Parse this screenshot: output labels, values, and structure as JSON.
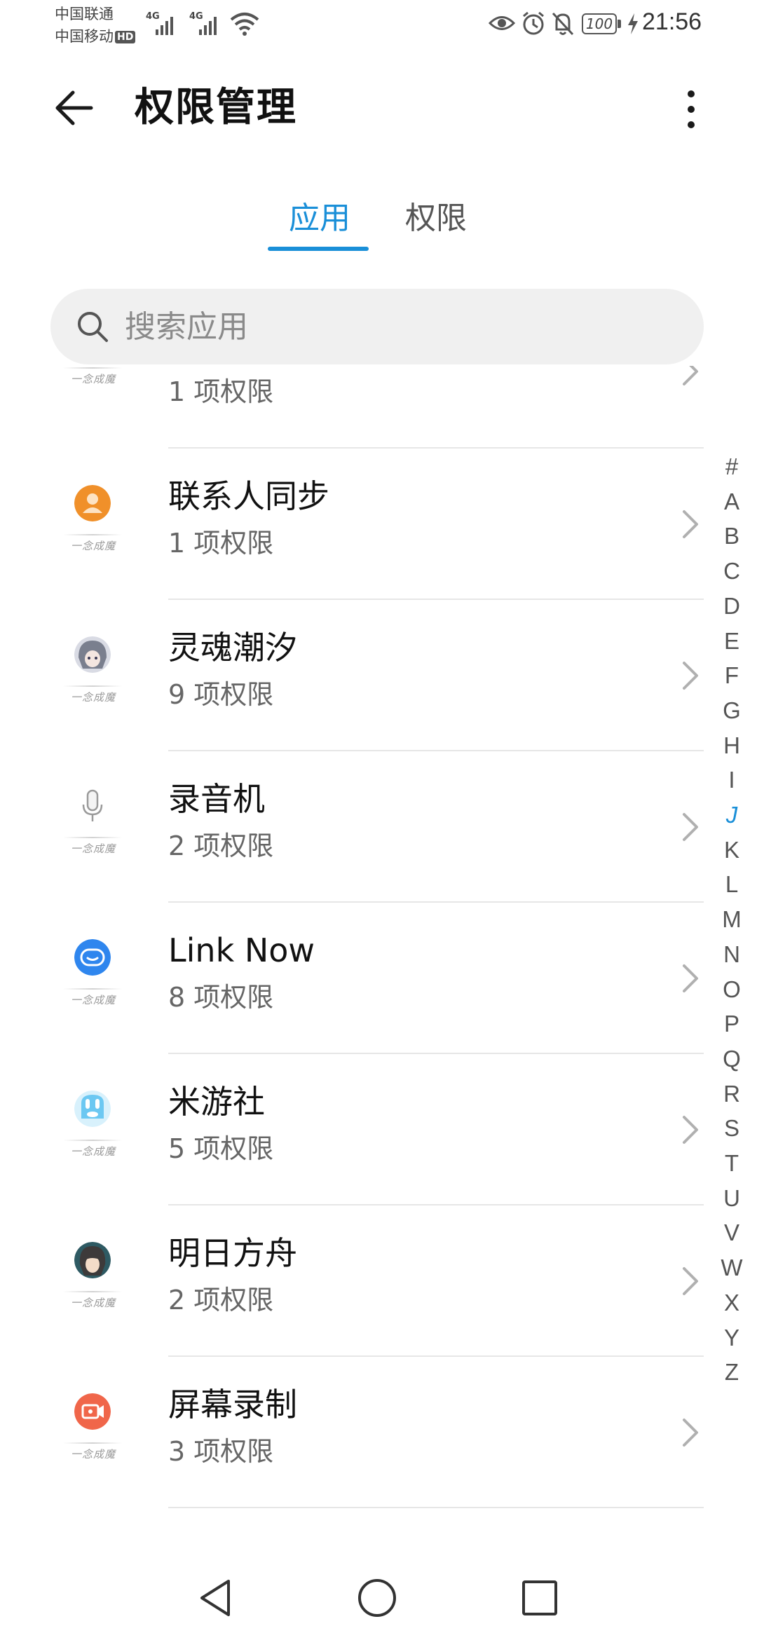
{
  "status_bar": {
    "carrier1": "中国联通",
    "carrier2": "中国移动",
    "hd_badge": "HD",
    "net1": "4G",
    "net2": "4G",
    "battery": "100",
    "time": "21:56"
  },
  "header": {
    "title": "权限管理"
  },
  "tabs": [
    {
      "label": "应用",
      "active": true
    },
    {
      "label": "权限",
      "active": false
    }
  ],
  "search": {
    "placeholder": "搜索应用",
    "value": ""
  },
  "watermark": "一念成魔",
  "apps": [
    {
      "name": "",
      "permissions": "1 项权限",
      "icon": "cloud-app-icon",
      "color": "#2b7de9"
    },
    {
      "name": "联系人同步",
      "permissions": "1 项权限",
      "icon": "contacts-sync-icon",
      "color": "#f0902a"
    },
    {
      "name": "灵魂潮汐",
      "permissions": "9 项权限",
      "icon": "anime-avatar-icon",
      "color": "#7a7f8e"
    },
    {
      "name": "录音机",
      "permissions": "2 项权限",
      "icon": "microphone-icon",
      "color": "#cfcfcf"
    },
    {
      "name": "Link Now",
      "permissions": "8 项权限",
      "icon": "link-now-icon",
      "color": "#2f86ee"
    },
    {
      "name": "米游社",
      "permissions": "5 项权限",
      "icon": "miyoushe-icon",
      "color": "#6cc8f2"
    },
    {
      "name": "明日方舟",
      "permissions": "2 项权限",
      "icon": "arknights-icon",
      "color": "#3d3a3a"
    },
    {
      "name": "屏幕录制",
      "permissions": "3 项权限",
      "icon": "screen-record-icon",
      "color": "#f0664a"
    }
  ],
  "alphabet": [
    "#",
    "A",
    "B",
    "C",
    "D",
    "E",
    "F",
    "G",
    "H",
    "I",
    "J",
    "K",
    "L",
    "M",
    "N",
    "O",
    "P",
    "Q",
    "R",
    "S",
    "T",
    "U",
    "V",
    "W",
    "X",
    "Y",
    "Z"
  ],
  "alphabet_active": "J",
  "accent_color": "#1a8fd8"
}
